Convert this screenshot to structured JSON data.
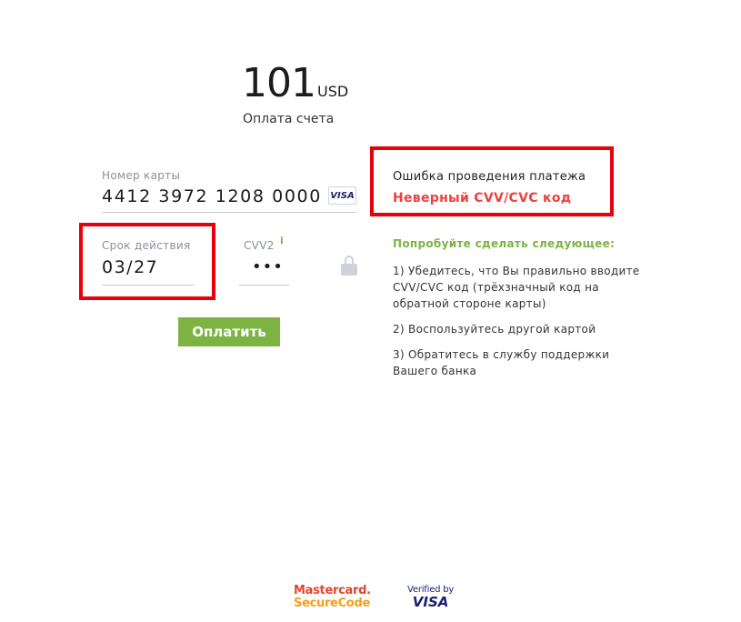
{
  "payment": {
    "amount": "101",
    "currency": "USD",
    "subtitle": "Оплата счета"
  },
  "card": {
    "number_label": "Номер карты",
    "number_value": "4412 3972 1208 0000",
    "brand": "VISA",
    "expiry_label": "Срок действия",
    "expiry_value": "03/27",
    "cvv_label": "CVV2",
    "cvv_info": "i",
    "cvv_value": "•••"
  },
  "pay_button": {
    "label": "Оплатить"
  },
  "error": {
    "title": "Ошибка проведения платежа",
    "message": "Неверный CVV/CVC код"
  },
  "help": {
    "title": "Попробуйте сделать следующее:",
    "steps": [
      "1) Убедитесь, что Вы правильно вводите CVV/CVC код (трёхзначный код на обратной стороне карты)",
      "2) Воспользуйтесь другой картой",
      "3) Обратитесь в службу поддержки Вашего банка"
    ]
  },
  "footer": {
    "mastercard_line1": "Mastercard.",
    "mastercard_line2": "SecureCode",
    "visa_line1": "Verified by",
    "visa_line2": "VISA"
  },
  "colors": {
    "accent_green": "#7cb342",
    "error_red": "#ef4040",
    "highlight_red": "#e8000b"
  }
}
